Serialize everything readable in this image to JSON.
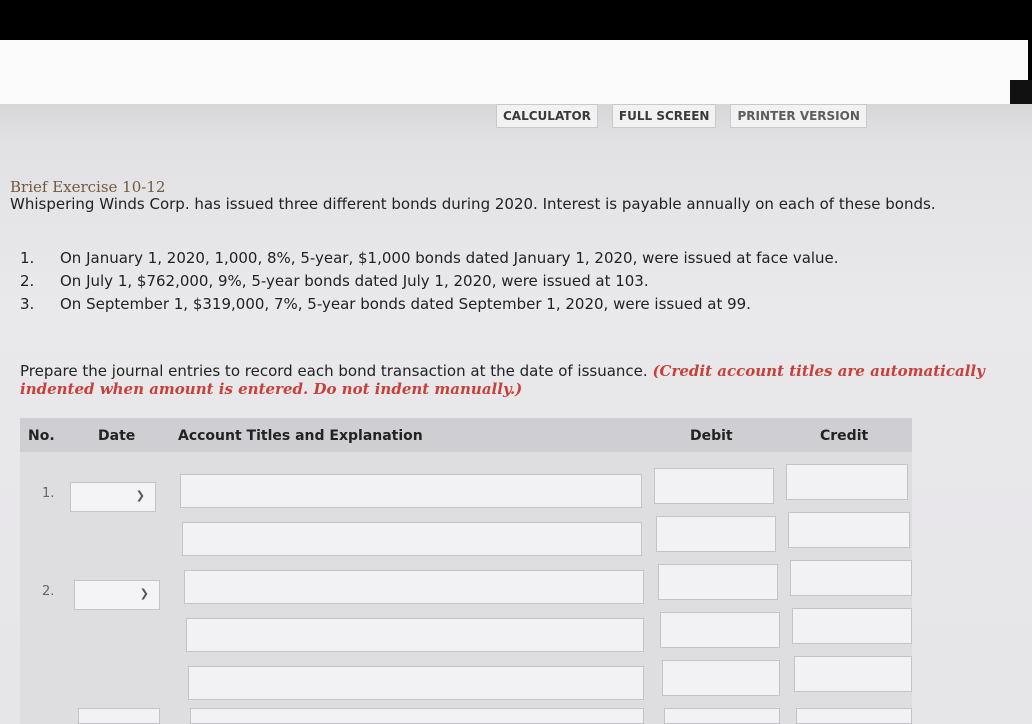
{
  "toolbar": {
    "calculator": "CALCULATOR",
    "full_screen": "FULL SCREEN",
    "printer_version": "PRINTER VERSION"
  },
  "exercise": {
    "title": "Brief Exercise 10-12",
    "intro": "Whispering Winds Corp. has issued three different bonds during 2020. Interest is payable annually on each of these bonds.",
    "items": [
      {
        "num": "1.",
        "text": "On January 1, 2020, 1,000, 8%, 5-year, $1,000 bonds dated January 1, 2020, were issued at face value."
      },
      {
        "num": "2.",
        "text": "On July 1, $762,000, 9%, 5-year bonds dated July 1, 2020, were issued at 103."
      },
      {
        "num": "3.",
        "text": "On September 1, $319,000, 7%, 5-year bonds dated September 1, 2020, were issued at 99."
      }
    ],
    "instructions": "Prepare the journal entries to record each bond transaction at the date of issuance.",
    "note": "(Credit account titles are automatically indented when amount is entered. Do not indent manually.)"
  },
  "table": {
    "headers": {
      "no": "No.",
      "date": "Date",
      "account": "Account Titles and Explanation",
      "debit": "Debit",
      "credit": "Credit"
    },
    "entries": [
      {
        "no": "1.",
        "date": ""
      },
      {
        "no": "2.",
        "date": ""
      }
    ]
  },
  "colors": {
    "note": "#c8403a",
    "heading": "#6f5b3e"
  }
}
